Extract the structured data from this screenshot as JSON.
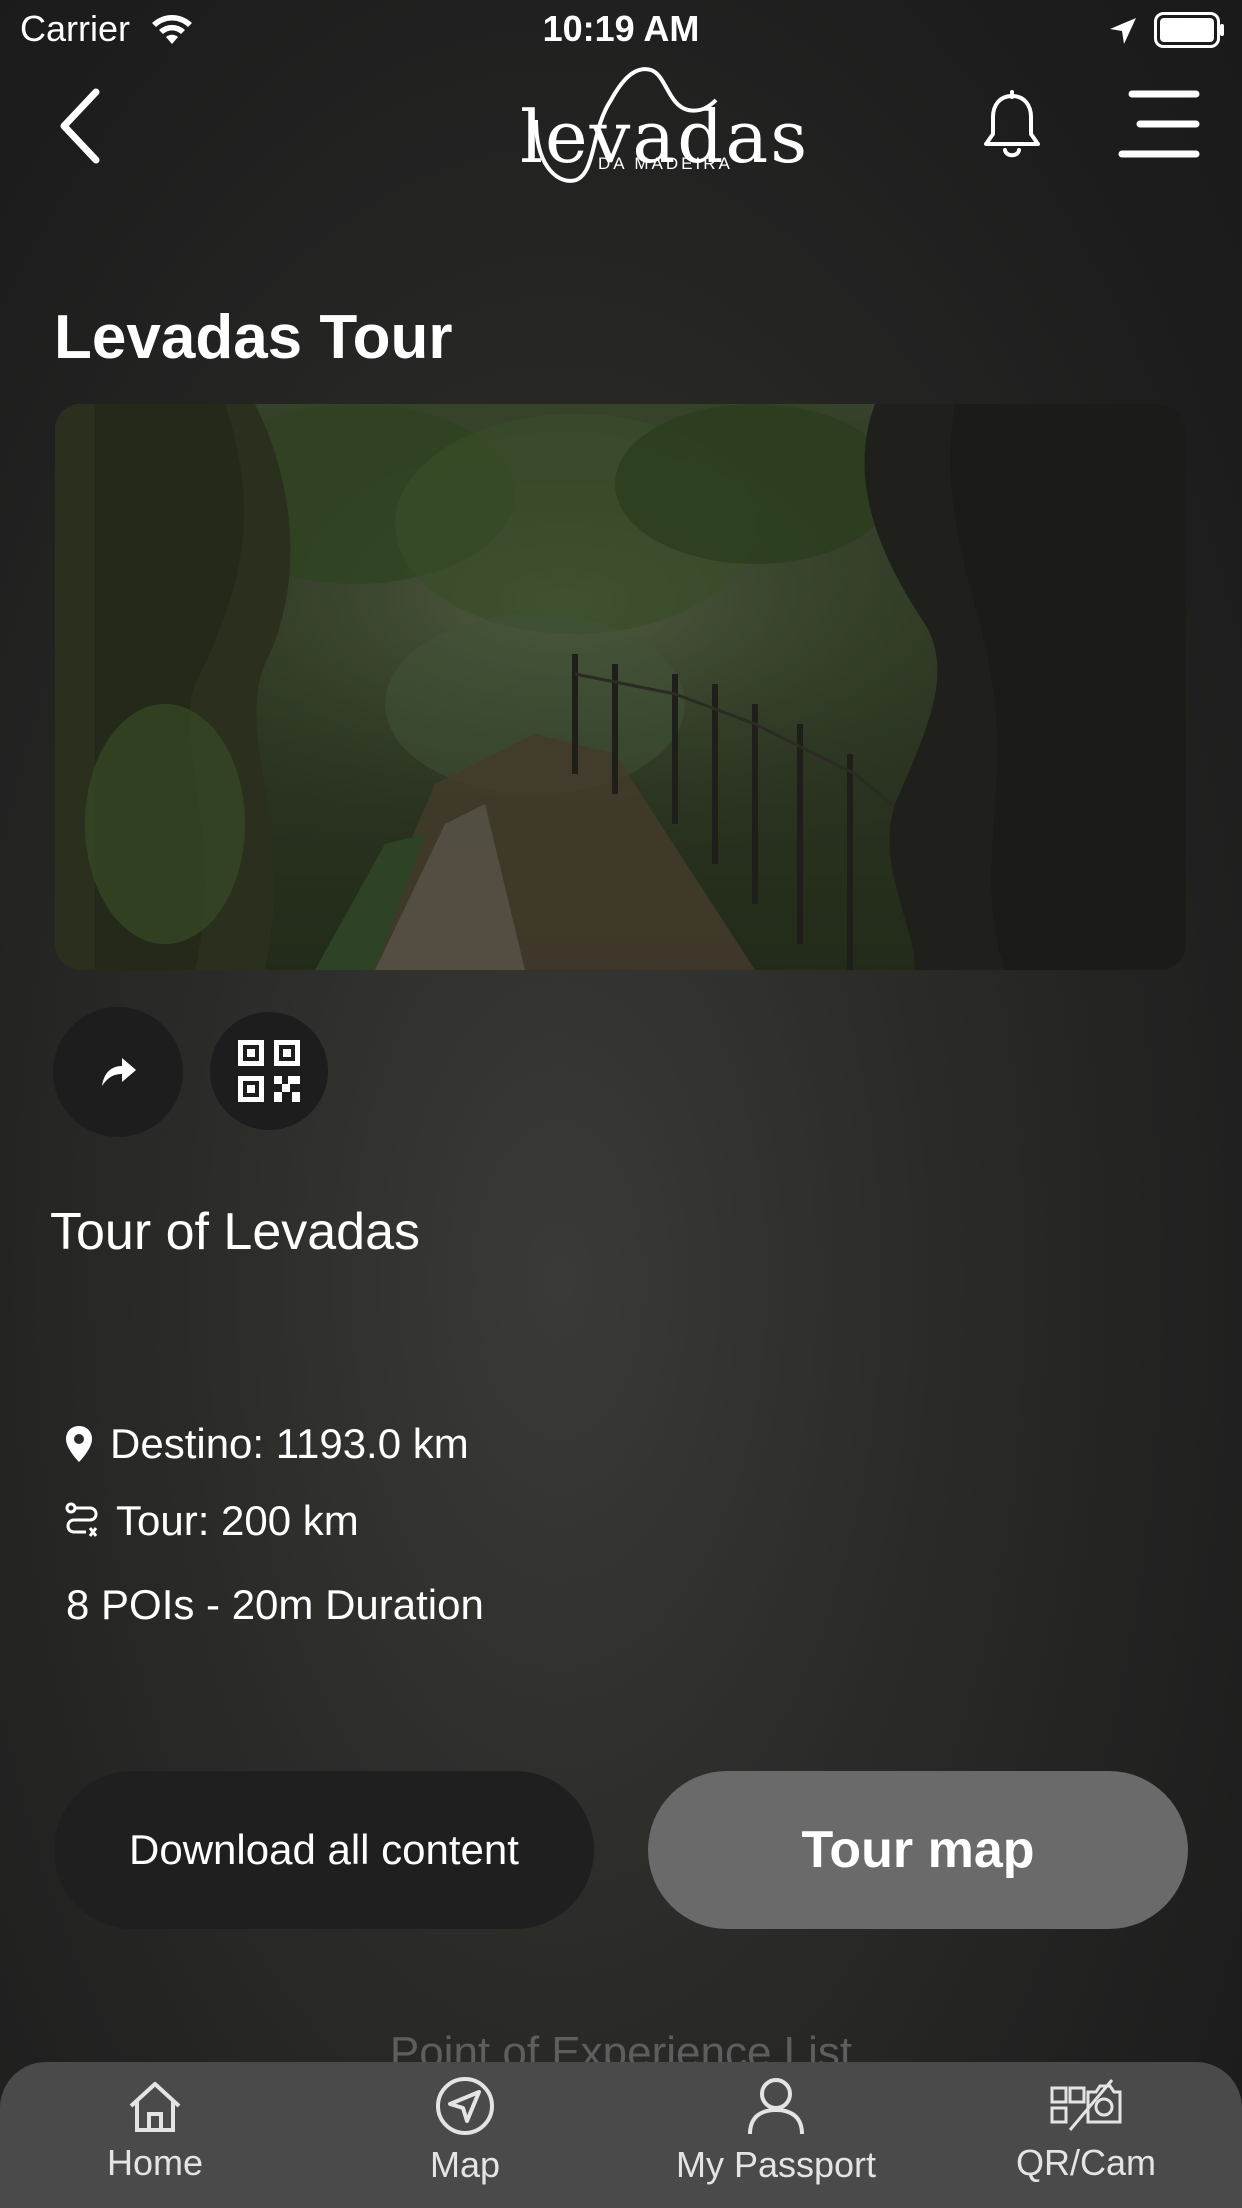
{
  "status_bar": {
    "carrier": "Carrier",
    "time": "10:19 AM"
  },
  "header": {
    "logo_main": "levadas",
    "logo_sub": "DA MADEIRA"
  },
  "page": {
    "title": "Levadas Tour"
  },
  "tour": {
    "name": "Tour of Levadas",
    "destination": "Destino: 1193.0 km",
    "distance": "Tour: 200 km",
    "summary": "8 POIs -  20m Duration"
  },
  "actions": {
    "download_label": "Download all content",
    "tour_map_label": "Tour map"
  },
  "list": {
    "heading": "Point of Experience List"
  },
  "tabs": [
    {
      "label": "Home",
      "icon": "home-icon"
    },
    {
      "label": "Map",
      "icon": "navigation-icon"
    },
    {
      "label": "My Passport",
      "icon": "user-icon"
    },
    {
      "label": "QR/Cam",
      "icon": "qr-camera-icon"
    }
  ]
}
